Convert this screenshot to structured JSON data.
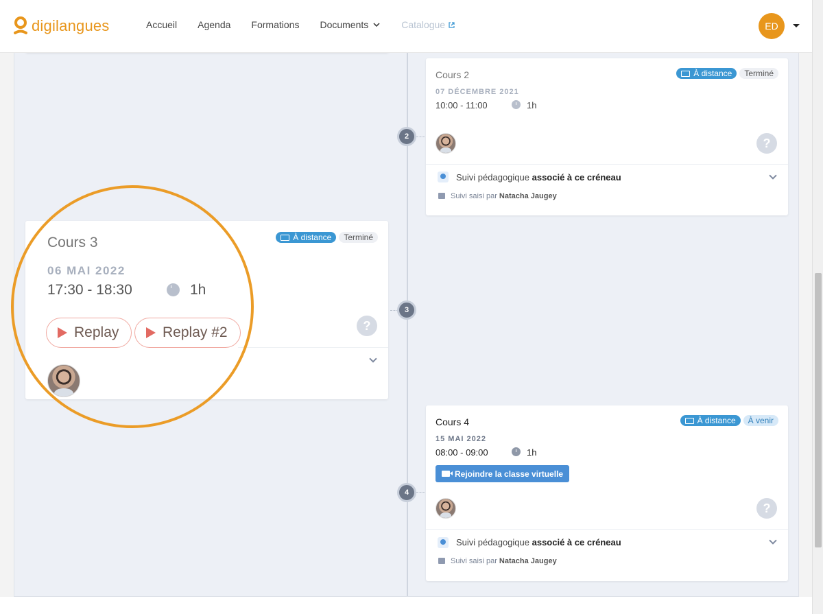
{
  "app": {
    "brand": "digilangues",
    "accent_color": "#e8961c"
  },
  "nav": {
    "items": [
      {
        "label": "Accueil"
      },
      {
        "label": "Agenda"
      },
      {
        "label": "Formations"
      },
      {
        "label": "Documents"
      },
      {
        "label": "Catalogue"
      }
    ],
    "user_initials": "ED"
  },
  "cards": {
    "cours2": {
      "title": "Cours 2",
      "badge_mode": "À distance",
      "badge_status": "Terminé",
      "date": "07 DÉCEMBRE 2021",
      "time": "10:00 - 11:00",
      "duration": "1h",
      "suivi_prefix": "Suivi pédagogique",
      "suivi_bold": "associé à ce créneau",
      "saisi_prefix": "Suivi saisi par",
      "saisi_name": "Natacha Jaugey",
      "help": "?"
    },
    "cours3": {
      "title": "Cours 3",
      "badge_mode": "À distance",
      "badge_status": "Terminé",
      "date": "06 MAI 2022",
      "time": "17:30 - 18:30",
      "duration": "1h",
      "replay1": "Replay",
      "replay2": "Replay #2",
      "help": "?"
    },
    "cours4": {
      "title": "Cours 4",
      "badge_mode": "À distance",
      "badge_status": "À venir",
      "date": "15 MAI 2022",
      "time": "08:00 - 09:00",
      "duration": "1h",
      "join_label": "Rejoindre la classe virtuelle",
      "suivi_prefix": "Suivi pédagogique",
      "suivi_bold": "associé à ce créneau",
      "saisi_prefix": "Suivi saisi par",
      "saisi_name": "Natacha Jaugey",
      "help": "?"
    }
  },
  "timeline": {
    "nodes": [
      "2",
      "3",
      "4"
    ]
  }
}
